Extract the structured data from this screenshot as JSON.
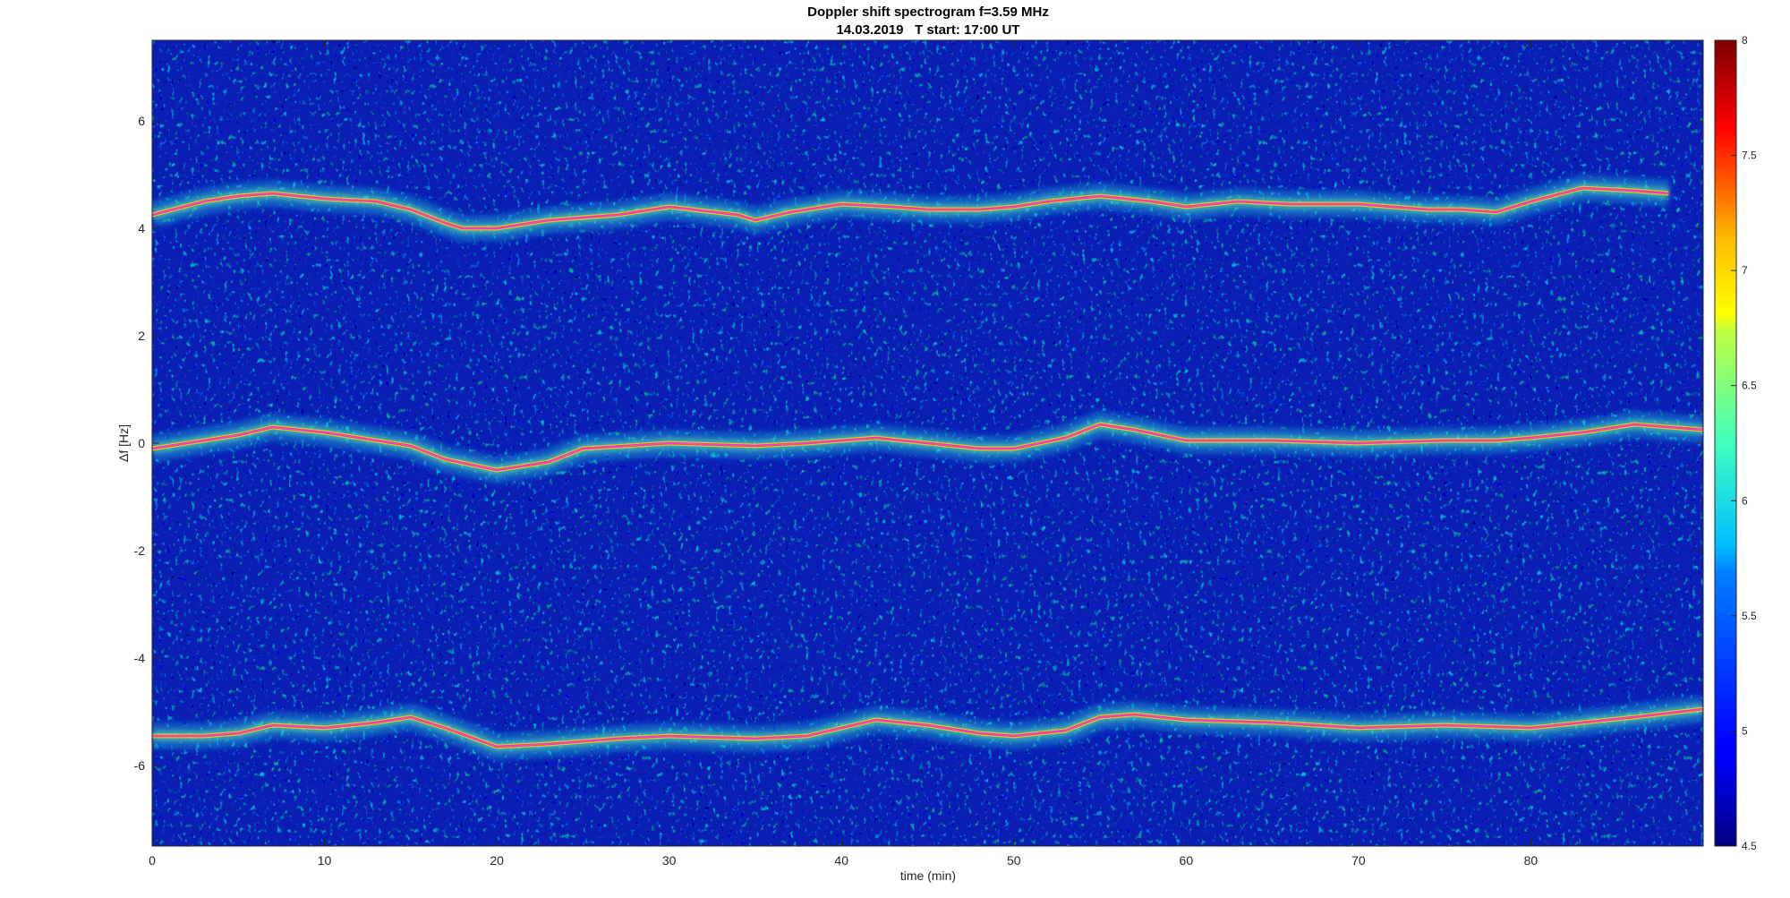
{
  "chart_data": {
    "type": "heatmap",
    "title": "Doppler shift spectrogram f=3.59 MHz",
    "subtitle": "14.03.2019   T start: 17:00 UT",
    "xlabel": "time (min)",
    "ylabel": "Δf [Hz]",
    "xlim": [
      0,
      90
    ],
    "ylim": [
      -7.5,
      7.5
    ],
    "x_ticks": [
      0,
      10,
      20,
      30,
      40,
      50,
      60,
      70,
      80
    ],
    "y_ticks": [
      -6,
      -4,
      -2,
      0,
      2,
      4,
      6
    ],
    "colormap": "jet",
    "colorbar": {
      "range": [
        4.5,
        8
      ],
      "ticks": [
        4.5,
        5,
        5.5,
        6,
        6.5,
        7,
        7.5,
        8
      ],
      "tick_labels": [
        "4.5",
        "5",
        "5.5",
        "6",
        "6.5",
        "7",
        "7.5",
        "8"
      ]
    },
    "grid": false,
    "series": [
      {
        "x": [
          0,
          3,
          5,
          7,
          10,
          13,
          15,
          17,
          18,
          20,
          23,
          27,
          30,
          34,
          35,
          37,
          40,
          43,
          45,
          48,
          50,
          52,
          55,
          58,
          60,
          63,
          66,
          70,
          74,
          76,
          78,
          80,
          83,
          86,
          88
        ],
        "y": [
          4.25,
          4.5,
          4.6,
          4.65,
          4.55,
          4.5,
          4.35,
          4.1,
          4.0,
          4.0,
          4.15,
          4.25,
          4.4,
          4.25,
          4.15,
          4.3,
          4.45,
          4.4,
          4.35,
          4.35,
          4.4,
          4.5,
          4.6,
          4.5,
          4.4,
          4.5,
          4.45,
          4.45,
          4.35,
          4.35,
          4.3,
          4.5,
          4.75,
          4.7,
          4.65
        ]
      },
      {
        "x": [
          0,
          3,
          5,
          7,
          10,
          13,
          15,
          17,
          20,
          23,
          25,
          30,
          35,
          38,
          40,
          42,
          45,
          48,
          50,
          53,
          55,
          57,
          60,
          65,
          70,
          75,
          78,
          80,
          83,
          86,
          90
        ],
        "y": [
          -0.1,
          0.05,
          0.15,
          0.3,
          0.2,
          0.05,
          -0.05,
          -0.3,
          -0.5,
          -0.35,
          -0.1,
          0.0,
          -0.05,
          0.0,
          0.05,
          0.1,
          0.0,
          -0.1,
          -0.1,
          0.1,
          0.35,
          0.25,
          0.05,
          0.05,
          0.0,
          0.05,
          0.05,
          0.1,
          0.2,
          0.35,
          0.25
        ]
      },
      {
        "x": [
          0,
          3,
          5,
          7,
          10,
          13,
          15,
          17,
          20,
          23,
          27,
          30,
          35,
          38,
          40,
          42,
          45,
          48,
          50,
          53,
          55,
          57,
          60,
          65,
          70,
          75,
          80,
          83,
          86,
          90
        ],
        "y": [
          -5.45,
          -5.45,
          -5.4,
          -5.25,
          -5.3,
          -5.2,
          -5.1,
          -5.3,
          -5.65,
          -5.6,
          -5.5,
          -5.45,
          -5.5,
          -5.45,
          -5.3,
          -5.15,
          -5.25,
          -5.4,
          -5.45,
          -5.35,
          -5.1,
          -5.05,
          -5.15,
          -5.2,
          -5.3,
          -5.25,
          -5.3,
          -5.2,
          -5.1,
          -4.95
        ]
      }
    ]
  }
}
